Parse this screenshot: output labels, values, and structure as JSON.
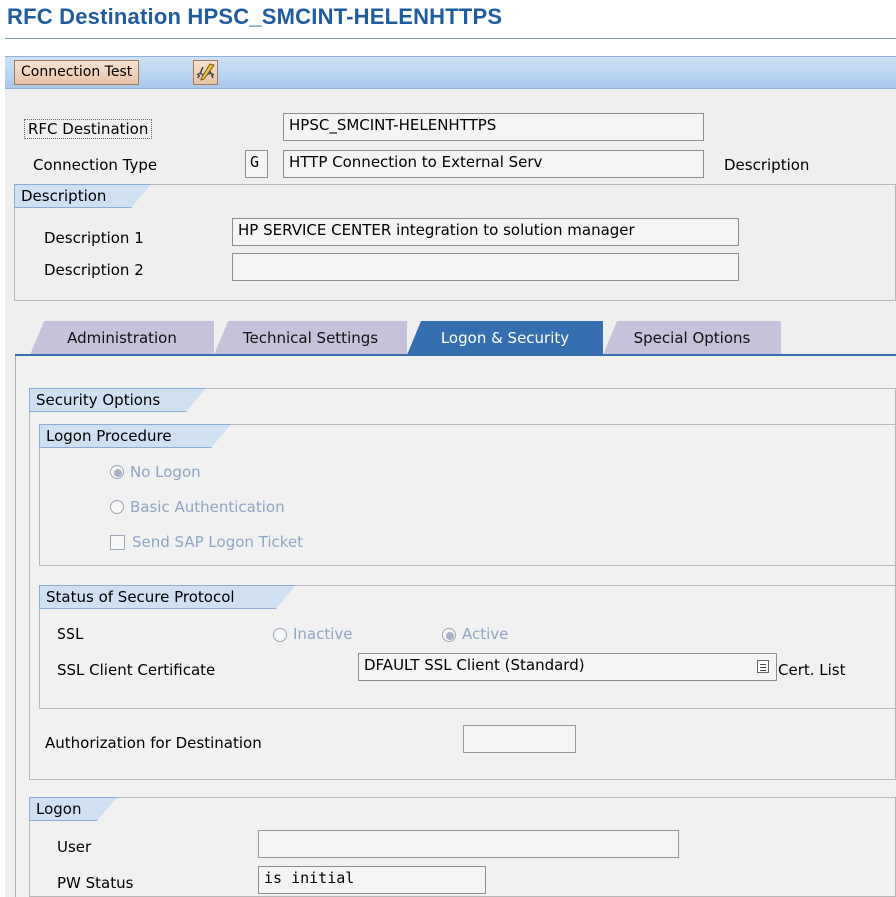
{
  "header": {
    "title": "RFC Destination HPSC_SMCINT-HELENHTTPS"
  },
  "toolbar": {
    "connection_test_label": "Connection Test",
    "glasses_icon": "glasses-icon"
  },
  "top": {
    "rfc_destination_label": "RFC Destination",
    "rfc_destination_value": "HPSC_SMCINT-HELENHTTPS",
    "connection_type_label": "Connection Type",
    "connection_type_code": "G",
    "connection_type_text": "HTTP Connection to External Serv",
    "description_link": "Description"
  },
  "description": {
    "title": "Description",
    "desc1_label": "Description 1",
    "desc1_value": "HP SERVICE CENTER integration to solution manager",
    "desc2_label": "Description 2",
    "desc2_value": ""
  },
  "tabs": [
    {
      "label": "Administration",
      "active": false
    },
    {
      "label": "Technical Settings",
      "active": false
    },
    {
      "label": "Logon & Security",
      "active": true
    },
    {
      "label": "Special Options",
      "active": false
    }
  ],
  "security": {
    "title": "Security Options",
    "logon_procedure": {
      "title": "Logon Procedure",
      "no_logon": "No Logon",
      "basic_auth": "Basic Authentication",
      "send_ticket": "Send SAP Logon Ticket"
    },
    "secure_protocol": {
      "title": "Status of Secure Protocol",
      "ssl_label": "SSL",
      "inactive": "Inactive",
      "active": "Active",
      "client_cert_label": "SSL Client Certificate",
      "client_cert_value": "DFAULT SSL Client (Standard)",
      "cert_list": "Cert. List"
    },
    "authorization_label": "Authorization for Destination",
    "authorization_value": ""
  },
  "logon": {
    "title": "Logon",
    "user_label": "User",
    "user_value": "",
    "pw_status_label": "PW Status",
    "pw_status_value": "is initial"
  }
}
